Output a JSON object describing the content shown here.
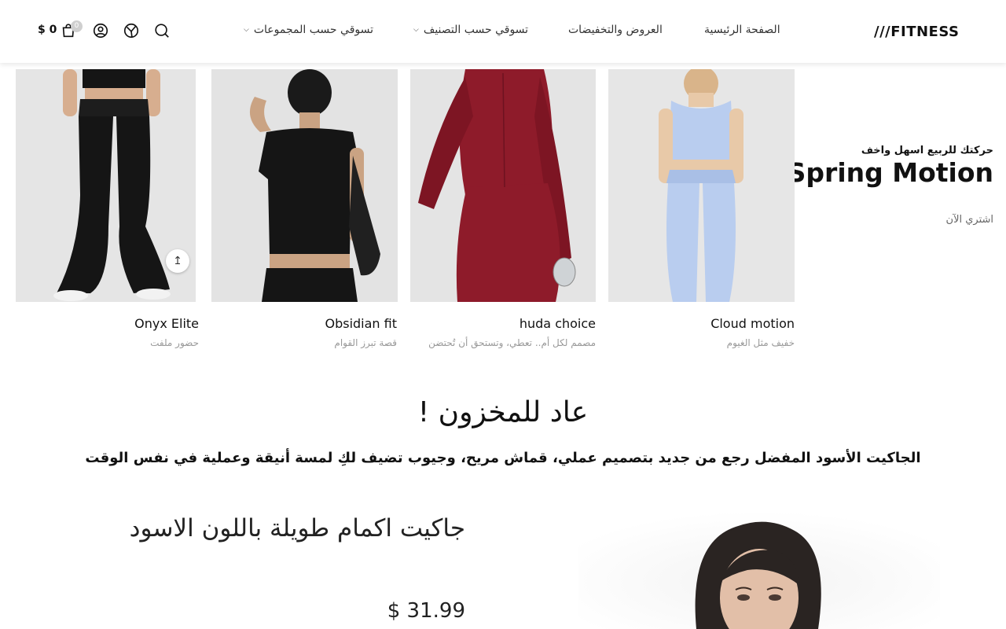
{
  "header": {
    "logo": "///FITNESS",
    "nav": {
      "home": "الصفحة الرئيسية",
      "offers": "العروض والتخفيضات",
      "shop_by_category": "تسوقي حسب التصنيف",
      "shop_by_collection": "تسوقي حسب المجموعات"
    },
    "cart_count": "0",
    "cart_total": "$ 0"
  },
  "promo": {
    "subtitle": "حركتك للربيع اسهل واخف",
    "title": "Spring Motion",
    "cta": "اشتري الآن"
  },
  "products": [
    {
      "name": "Cloud motion",
      "desc": "خفيف مثل الغيوم"
    },
    {
      "name": "huda choice",
      "desc": "مصمم لكل أم.. تعطي، وتستحق أن تُحتضن"
    },
    {
      "name": "Obsidian fit",
      "desc": "قصة تبرز القوام"
    },
    {
      "name": "Onyx Elite",
      "desc": "حضور ملفت"
    }
  ],
  "back_in_stock": {
    "title": "عاد للمخزون !",
    "description": "الجاكيت الأسود المفضل رجع من جديد بتصميم عملي، قماش مريح، وجيوب تضيف لكِ لمسة أنيقة وعملية في نفس الوقت"
  },
  "featured": {
    "title": "جاكيت اكمام طويلة باللون الاسود",
    "price": "$ 31.99"
  },
  "colors": {
    "light_blue": "#b9cdef",
    "burgundy": "#8e1b2a",
    "black": "#151515",
    "photo_bg": "#e8e8e8"
  }
}
